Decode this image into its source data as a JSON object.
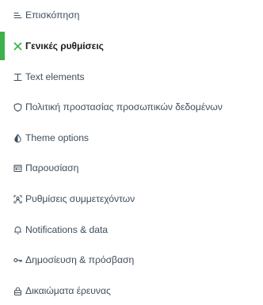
{
  "nav": {
    "accent_color": "#3bb34a",
    "text_color": "#3f4f5e",
    "active_text_color": "#1c1c1c",
    "items": [
      {
        "label": "Επισκόπηση",
        "icon": "overview-lines-icon",
        "active": false
      },
      {
        "label": "Γενικές ρυθμίσεις",
        "icon": "tools-icon",
        "active": true
      },
      {
        "label": "Text elements",
        "icon": "text-cursor-icon",
        "active": false
      },
      {
        "label": "Πολιτική προστασίας προσωπικών δεδομένων",
        "icon": "shield-icon",
        "active": false
      },
      {
        "label": "Theme options",
        "icon": "contrast-drop-icon",
        "active": false
      },
      {
        "label": "Παρουσίαση",
        "icon": "presentation-icon",
        "active": false
      },
      {
        "label": "Ρυθμίσεις συμμετεχόντων",
        "icon": "participant-settings-icon",
        "active": false
      },
      {
        "label": "Notifications & data",
        "icon": "bell-icon",
        "active": false
      },
      {
        "label": "Δημοσίευση & πρόσβαση",
        "icon": "key-icon",
        "active": false
      },
      {
        "label": "Δικαιώματα έρευνας",
        "icon": "lock-icon",
        "active": false
      }
    ]
  }
}
